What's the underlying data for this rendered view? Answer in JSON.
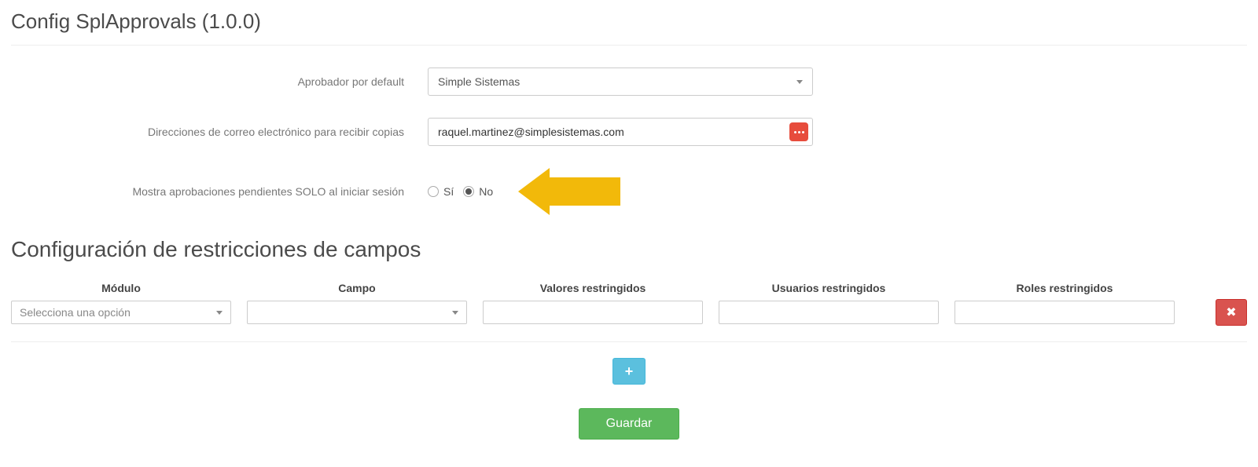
{
  "page_title": "Config SplApprovals (1.0.0)",
  "labels": {
    "aprobador": "Aprobador por default",
    "direcciones": "Direcciones de correo electrónico para recibir copias",
    "mostrar_pendientes": "Mostra aprobaciones pendientes SOLO al iniciar sesión"
  },
  "aprobador_value": "Simple Sistemas",
  "direcciones_value": "raquel.martinez@simplesistemas.com",
  "radio": {
    "si": "Sí",
    "no": "No",
    "selected": "no"
  },
  "section_title": "Configuración de restricciones de campos",
  "columns": {
    "modulo": "Módulo",
    "campo": "Campo",
    "valores": "Valores restringidos",
    "usuarios": "Usuarios restringidos",
    "roles": "Roles restringidos"
  },
  "row": {
    "modulo_placeholder": "Selecciona una opción",
    "campo_placeholder": "",
    "valores_value": "",
    "usuarios_value": "",
    "roles_value": ""
  },
  "buttons": {
    "add": "+",
    "delete": "✖",
    "save": "Guardar"
  }
}
